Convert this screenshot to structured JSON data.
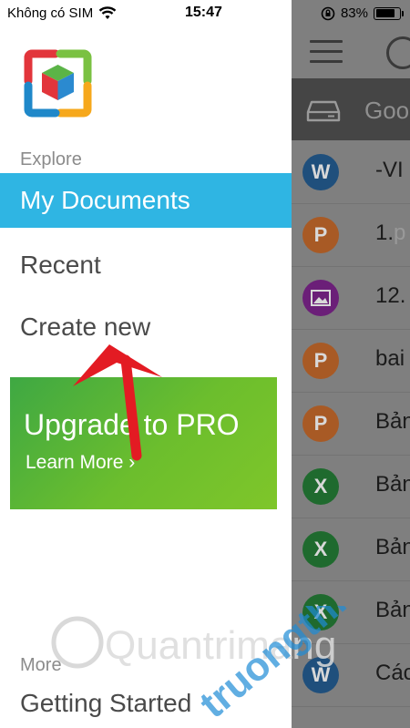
{
  "status_bar": {
    "carrier": "Không có SIM",
    "time": "15:47",
    "battery": "83%",
    "battery_level": 0.83
  },
  "drawer": {
    "explore_label": "Explore",
    "items": [
      {
        "label": "My Documents",
        "active": true
      },
      {
        "label": "Recent",
        "active": false
      },
      {
        "label": "Create new",
        "active": false
      }
    ],
    "promo": {
      "title": "Upgrade to PRO",
      "link": "Learn More ›"
    },
    "more_label": "More",
    "more_items": [
      {
        "label": "Getting Started"
      }
    ]
  },
  "document_list": {
    "location": "Goo",
    "rows": [
      {
        "type": "W",
        "name": "-VI",
        "ext": "",
        "color": "#1f4f7c"
      },
      {
        "type": "P",
        "name": "1.",
        "ext": "p",
        "color": "#a85a25"
      },
      {
        "type": "img",
        "name": "12.",
        "ext": "",
        "color": "#6b1f78"
      },
      {
        "type": "P",
        "name": "bai",
        "ext": "",
        "color": "#a85a25"
      },
      {
        "type": "P",
        "name": "Bản",
        "ext": "",
        "color": "#a85a25"
      },
      {
        "type": "X",
        "name": "Bản",
        "ext": "",
        "color": "#1f6a2e"
      },
      {
        "type": "X",
        "name": "Bản",
        "ext": "",
        "color": "#1f6a2e"
      },
      {
        "type": "X",
        "name": "Bản",
        "ext": "",
        "color": "#1f6a2e"
      },
      {
        "type": "W",
        "name": "Các",
        "ext": "",
        "color": "#1f4f7c"
      }
    ]
  },
  "watermark": {
    "text_main": "Quantrimang",
    "text_accent": "truongthi.top"
  },
  "colors": {
    "active_item": "#2fb5e3",
    "promo_green": "#6cbe2d",
    "annotation_red": "#e31b23"
  }
}
